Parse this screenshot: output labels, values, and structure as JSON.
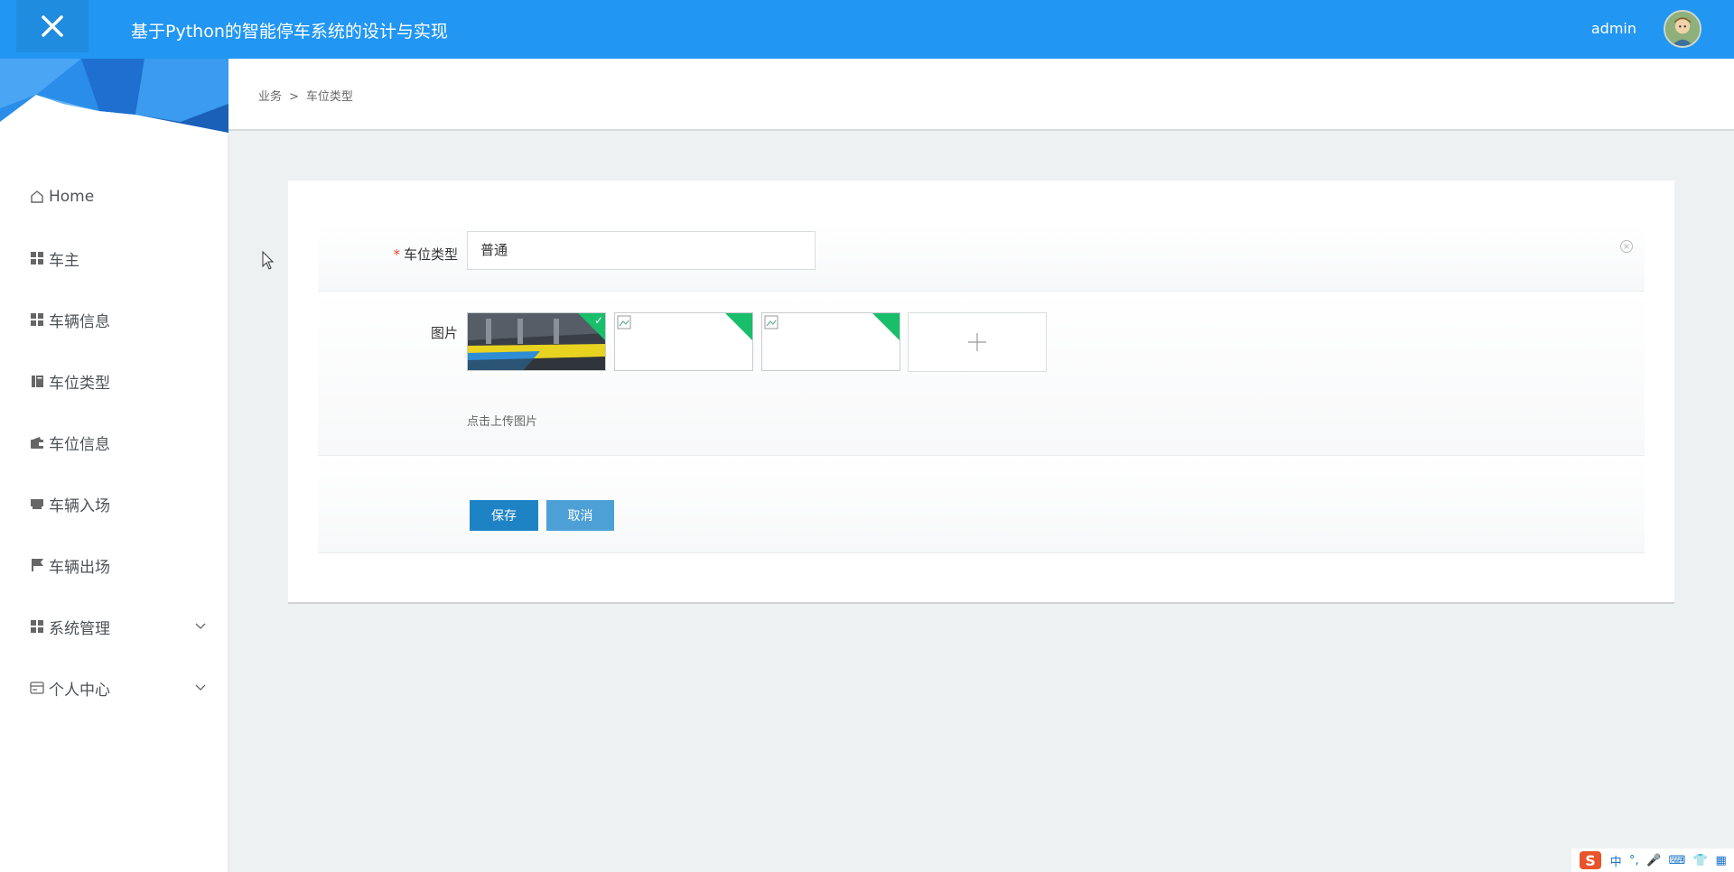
{
  "header": {
    "title": "基于Python的智能停车系统的设计与实现",
    "user": "admin",
    "close_icon": "close-icon",
    "bg_color": "#2196f3"
  },
  "sidebar": {
    "items": [
      {
        "label": "Home",
        "icon": "home-icon"
      },
      {
        "label": "车主",
        "icon": "grid-icon"
      },
      {
        "label": "车辆信息",
        "icon": "grid-icon"
      },
      {
        "label": "车位类型",
        "icon": "book-icon"
      },
      {
        "label": "车位信息",
        "icon": "wallet-icon"
      },
      {
        "label": "车辆入场",
        "icon": "inbox-icon"
      },
      {
        "label": "车辆出场",
        "icon": "flag-icon"
      },
      {
        "label": "系统管理",
        "icon": "grid-icon",
        "expandable": true
      },
      {
        "label": "个人中心",
        "icon": "card-icon",
        "expandable": true
      }
    ]
  },
  "breadcrumb": {
    "parent": "业务",
    "separator": ">",
    "current": "车位类型"
  },
  "form": {
    "type_label": "车位类型",
    "required_mark": "*",
    "type_value": "普通",
    "image_label": "图片",
    "upload_hint": "点击上传图片",
    "save_label": "保存",
    "cancel_label": "取消"
  },
  "ime": {
    "items": [
      "中",
      "°,",
      "🎤",
      "⌨",
      "👕",
      "▦"
    ]
  }
}
